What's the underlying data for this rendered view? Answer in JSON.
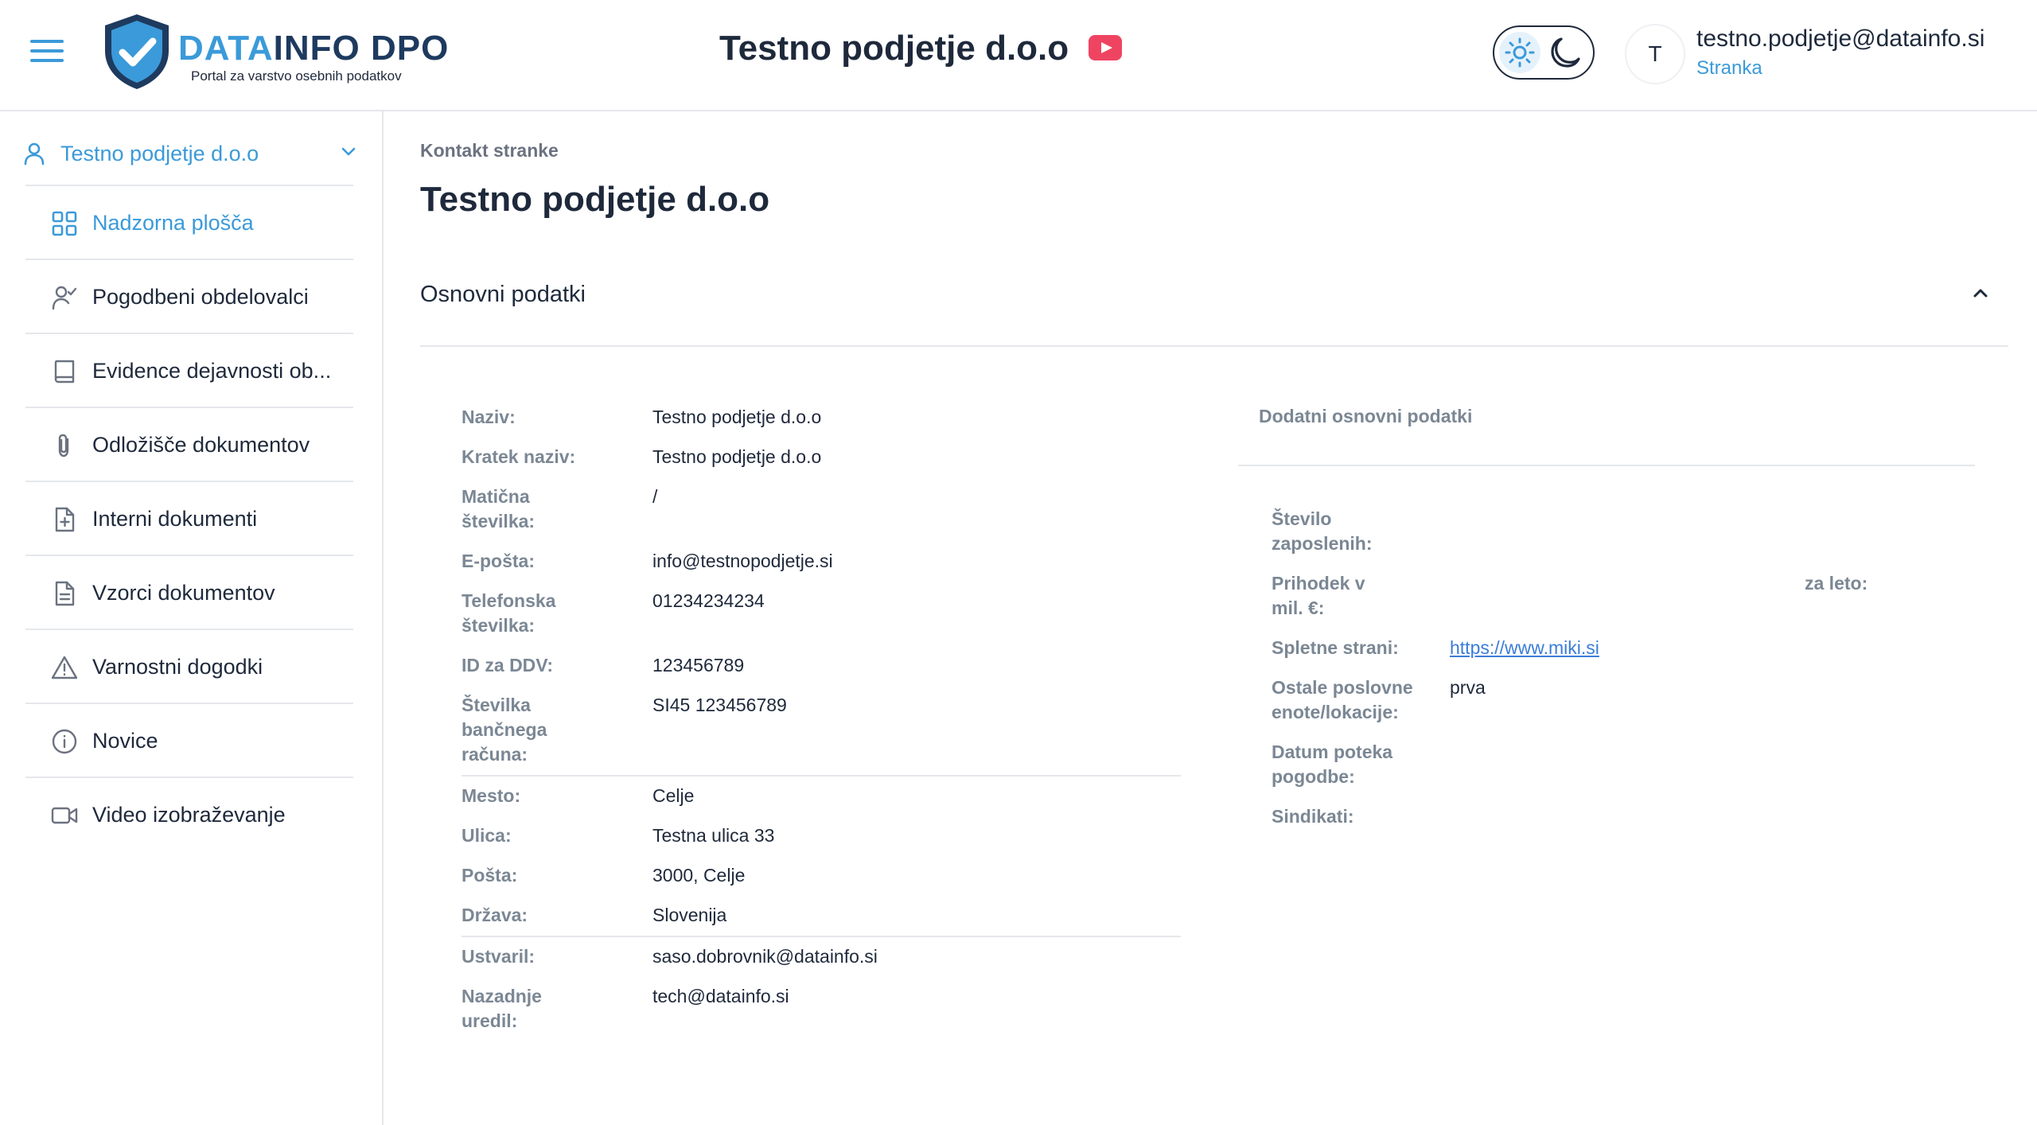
{
  "header": {
    "logo_text_a": "DATA",
    "logo_text_b": "INFO DPO",
    "logo_subtitle": "Portal za varstvo osebnih podatkov",
    "company_title": "Testno podjetje d.o.o",
    "user_avatar_initial": "T",
    "user_email": "testno.podjetje@datainfo.si",
    "user_role": "Stranka"
  },
  "sidebar": {
    "org_label": "Testno podjetje d.o.o",
    "items": [
      {
        "label": "Nadzorna plošča",
        "icon": "dashboard-grid-icon",
        "active": true
      },
      {
        "label": "Pogodbeni obdelovalci",
        "icon": "user-check-icon",
        "active": false
      },
      {
        "label": "Evidence dejavnosti ob...",
        "icon": "book-icon",
        "active": false
      },
      {
        "label": "Odložišče dokumentov",
        "icon": "paperclip-icon",
        "active": false
      },
      {
        "label": "Interni dokumenti",
        "icon": "file-plus-icon",
        "active": false
      },
      {
        "label": "Vzorci dokumentov",
        "icon": "file-text-icon",
        "active": false
      },
      {
        "label": "Varnostni dogodki",
        "icon": "warning-triangle-icon",
        "active": false
      },
      {
        "label": "Novice",
        "icon": "info-circle-icon",
        "active": false
      },
      {
        "label": "Video izobraževanje",
        "icon": "video-camera-icon",
        "active": false
      }
    ]
  },
  "main": {
    "breadcrumb": "Kontakt stranke",
    "title": "Testno podjetje d.o.o",
    "section_title": "Osnovni podatki",
    "basic_group1": [
      {
        "label": "Naziv:",
        "value": "Testno podjetje d.o.o"
      },
      {
        "label": "Kratek naziv:",
        "value": "Testno podjetje d.o.o"
      },
      {
        "label": "Matična številka:",
        "value": "/"
      },
      {
        "label": "E-pošta:",
        "value": "info@testnopodjetje.si"
      },
      {
        "label": "Telefonska številka:",
        "value": "01234234234"
      },
      {
        "label": "ID za DDV:",
        "value": "123456789"
      },
      {
        "label": "Številka bančnega računa:",
        "value": "SI45 123456789"
      }
    ],
    "basic_group2": [
      {
        "label": "Mesto:",
        "value": "Celje"
      },
      {
        "label": "Ulica:",
        "value": "Testna ulica 33"
      },
      {
        "label": "Pošta:",
        "value": "3000, Celje"
      },
      {
        "label": "Država:",
        "value": "Slovenija"
      }
    ],
    "basic_group3": [
      {
        "label": "Ustvaril:",
        "value": "saso.dobrovnik@datainfo.si"
      },
      {
        "label": "Nazadnje uredil:",
        "value": "tech@datainfo.si"
      }
    ],
    "additional": {
      "title": "Dodatni osnovni podatki",
      "employees_label": "Število zaposlenih:",
      "employees_value": "",
      "income_label": "Prihodek v mil. €:",
      "income_value": "",
      "income_year_label": "za leto:",
      "website_label": "Spletne strani:",
      "website_value": "https://www.miki.si",
      "other_units_label": "Ostale poslovne enote/lokacije:",
      "other_units_value": "prva",
      "contract_expiry_label": "Datum poteka pogodbe:",
      "contract_expiry_value": "",
      "unions_label": "Sindikati:",
      "unions_value": ""
    }
  },
  "colors": {
    "accent": "#3b9ad9",
    "brand_dark": "#1e3a5f",
    "youtube_red": "#ef4461",
    "label_gray": "#7b8794"
  }
}
